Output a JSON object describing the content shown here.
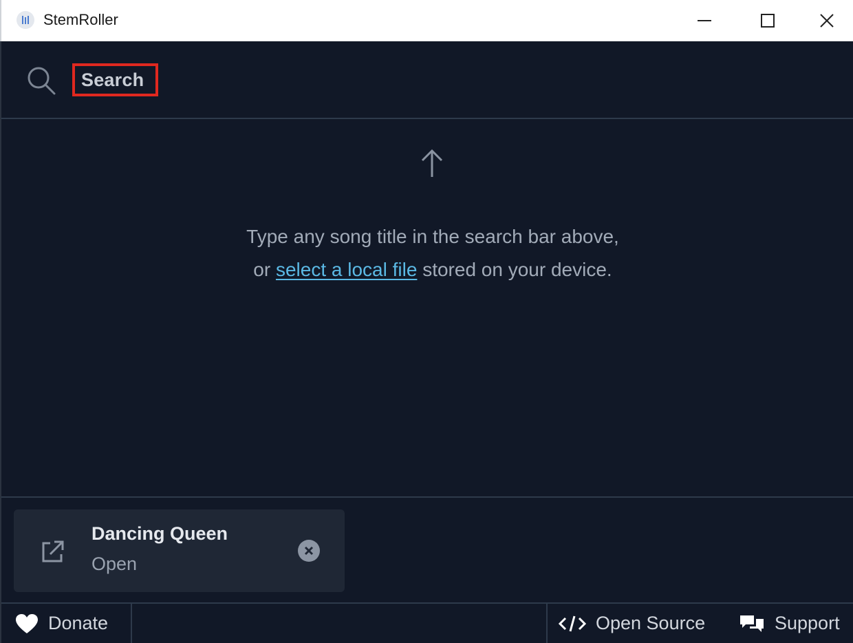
{
  "window": {
    "title": "StemRoller"
  },
  "search": {
    "placeholder": "Search"
  },
  "empty_state": {
    "line1": "Type any song title in the search bar above,",
    "line2_prefix": "or ",
    "link_text": "select a local file",
    "line2_suffix": " stored on your device."
  },
  "queue": {
    "items": [
      {
        "title": "Dancing Queen",
        "status": "Open"
      }
    ]
  },
  "footer": {
    "donate_label": "Donate",
    "open_source_label": "Open Source",
    "support_label": "Support"
  },
  "colors": {
    "background": "#111827",
    "card": "#1f2735",
    "link": "#5bb9e5",
    "highlight_box": "#e0281f"
  },
  "icons": [
    "app-icon",
    "minimize-icon",
    "maximize-icon",
    "close-icon",
    "search-icon",
    "arrow-up-icon",
    "external-link-icon",
    "remove-icon",
    "heart-icon",
    "code-icon",
    "chat-icon"
  ]
}
